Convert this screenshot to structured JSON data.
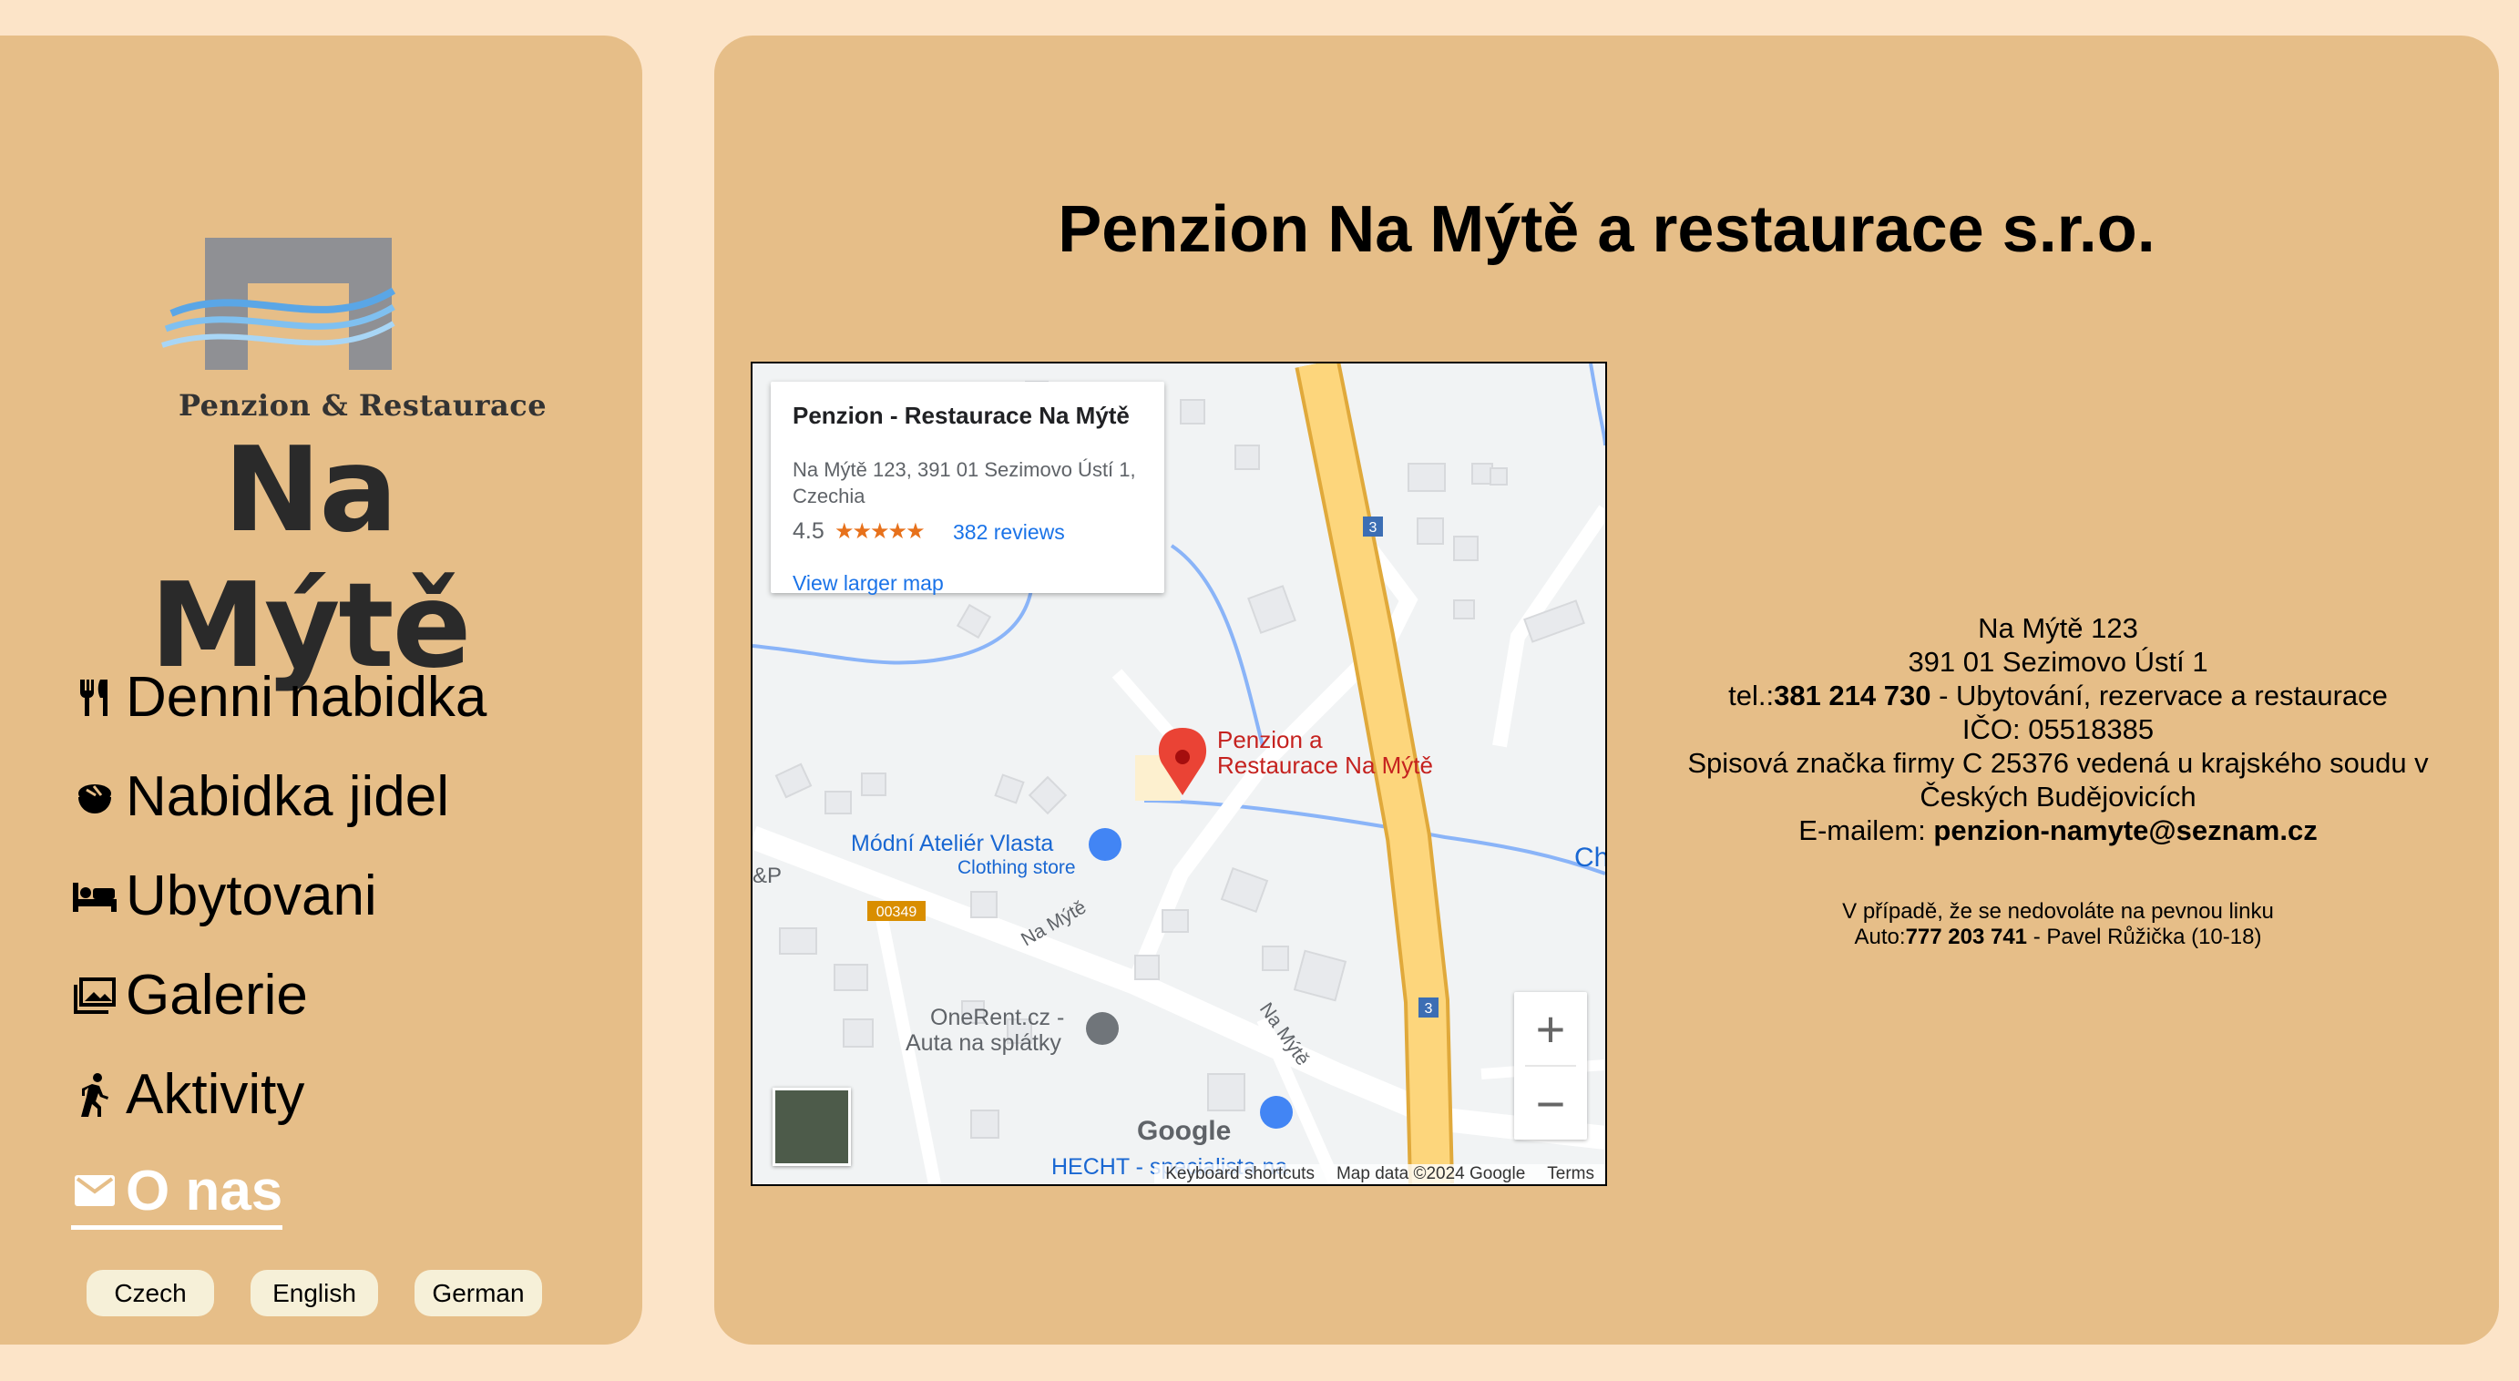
{
  "logo": {
    "subtitle": "Penzion & Restaurace",
    "name": "Na Mýtě"
  },
  "nav": {
    "items": [
      {
        "label": "Denni nabidka",
        "icon": "fork-knife-icon"
      },
      {
        "label": "Nabidka jidel",
        "icon": "bowl-icon"
      },
      {
        "label": "Ubytovani",
        "icon": "bed-icon"
      },
      {
        "label": "Galerie",
        "icon": "gallery-icon"
      },
      {
        "label": "Aktivity",
        "icon": "hiking-icon"
      },
      {
        "label": "O nas",
        "icon": "mail-icon",
        "active": true
      }
    ]
  },
  "languages": [
    "Czech",
    "English",
    "German"
  ],
  "main": {
    "title": "Penzion Na Mýtě a restaurace s.r.o.",
    "map": {
      "place_name": "Penzion - Restaurace Na Mýtě",
      "address": "Na Mýtě 123, 391 01 Sezimovo Ústí 1, Czechia",
      "rating": "4.5",
      "stars": "★★★★★",
      "reviews": "382 reviews",
      "larger_map": "View larger map",
      "marker_label_1": "Penzion a",
      "marker_label_2": "Restaurace Na Mýtě",
      "poi_1": "Módní Ateliér Vlasta",
      "poi_1_type": "Clothing store",
      "poi_2a": "OneRent.cz -",
      "poi_2b": "Auta na splátky",
      "road_na_myte": "Na Mýtě",
      "road_number": "00349",
      "route_3": "3",
      "poi_hecht": "HECHT - specialista na",
      "edge_left": "&P",
      "edge_right": "Ch",
      "google": "Google",
      "shortcuts": "Keyboard shortcuts",
      "map_data": "Map data ©2024 Google",
      "terms": "Terms",
      "zoom_in": "+",
      "zoom_out": "−"
    },
    "contact": {
      "street": "Na Mýtě 123",
      "city": "391 01 Sezimovo Ústí 1",
      "tel_prefix": "tel.:",
      "tel": "381 214 730",
      "tel_suffix": " - Ubytování, rezervace a restaurace",
      "ico": "IČO: 05518385",
      "registry": "Spisová značka firmy C 25376 vedená u krajského soudu v Českých Budějovicích",
      "email_prefix": "E-mailem: ",
      "email": "penzion-namyte@seznam.cz",
      "note_line": "V případě, že se nedovoláte na pevnou linku",
      "mobile_prefix": "Auto:",
      "mobile": "777 203 741",
      "mobile_suffix": " - Pavel Růžička (10-18)"
    }
  }
}
